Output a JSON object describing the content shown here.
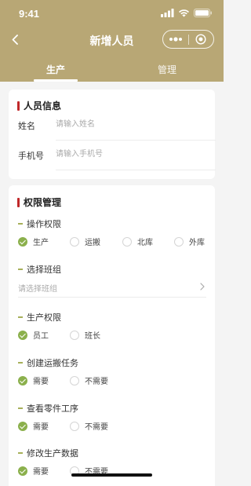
{
  "status_bar": {
    "time": "9:41"
  },
  "nav": {
    "title": "新增人员"
  },
  "tabs": [
    {
      "label": "生产",
      "active": true
    },
    {
      "label": "管理",
      "active": false
    }
  ],
  "personal_info": {
    "title": "人员信息",
    "fields": [
      {
        "label": "姓名",
        "value": "",
        "placeholder": "请输入姓名"
      },
      {
        "label": "手机号",
        "value": "",
        "placeholder": "请输入手机号"
      }
    ]
  },
  "permissions": {
    "title": "权限管理",
    "operation": {
      "label": "操作权限",
      "options": [
        "生产",
        "运搬",
        "北库",
        "外库"
      ],
      "selected": "生产"
    },
    "team": {
      "label": "选择班组",
      "placeholder": "请选择班组"
    },
    "production": {
      "label": "生产权限",
      "options": [
        "员工",
        "班长"
      ],
      "selected": "员工"
    },
    "create_transport_task": {
      "label": "创建运搬任务",
      "options": [
        "需要",
        "不需要"
      ],
      "selected": "需要"
    },
    "view_part_process": {
      "label": "查看零件工序",
      "options": [
        "需要",
        "不需要"
      ],
      "selected": "需要"
    },
    "modify_production_data": {
      "label": "修改生产数据",
      "options": [
        "需要",
        "不需要"
      ],
      "selected": "需要"
    }
  },
  "colors": {
    "header_bg": "#b8a775",
    "accent_red": "#c0282a",
    "checked_green": "#8bb04c",
    "dash_green": "#a7b05a"
  },
  "icons": [
    "signal-icon",
    "wifi-icon",
    "battery-icon",
    "back-arrow-icon",
    "more-dots-icon",
    "close-target-icon",
    "chevron-right-icon",
    "radio-checked-icon",
    "radio-unchecked-icon"
  ]
}
